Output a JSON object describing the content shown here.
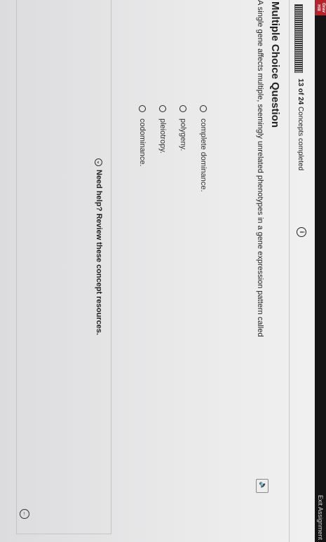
{
  "header": {
    "brand": "Grav Hill",
    "exit_label": "Exit Assignment"
  },
  "progress": {
    "count": "13 of 24",
    "label": "Concepts completed",
    "info_icon": "info-icon"
  },
  "question": {
    "type": "Multiple Choice Question",
    "text": "A single gene affects multiple, seemingly unrelated phenotypes in a gene expression pattern called",
    "options": [
      "complete dominance.",
      "polygeny.",
      "pleiotropy.",
      "codominance."
    ]
  },
  "help": {
    "label": "Need help? Review these concept resources.",
    "icon": "chevron-down-icon"
  },
  "icons": {
    "tts": "speaker-icon",
    "back": "back-icon"
  }
}
